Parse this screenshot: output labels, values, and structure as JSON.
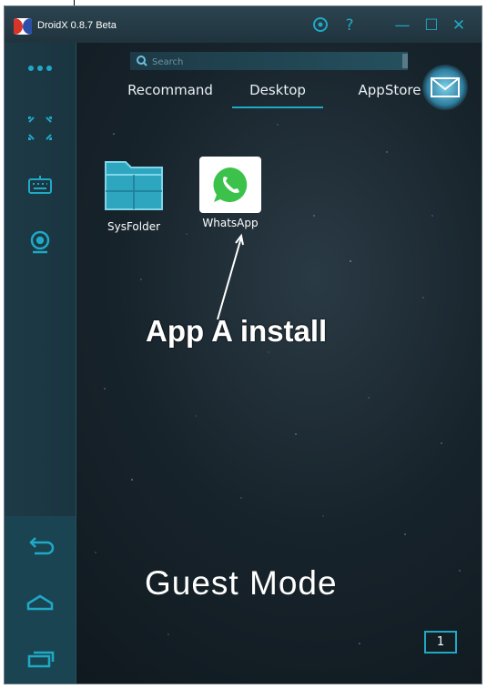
{
  "window": {
    "title": "DroidX 0.8.7 Beta",
    "accent_color": "#1fa9c6",
    "titlebar_icons": [
      "settings-icon",
      "help-icon",
      "minimize-icon",
      "maximize-icon",
      "close-icon"
    ],
    "help_glyph": "?",
    "minimize_glyph": "—",
    "maximize_glyph": "☐",
    "close_glyph": "✕"
  },
  "sidebar": {
    "top_icons": [
      "more-dots-icon",
      "fullscreen-icon",
      "keyboard-icon",
      "camera-icon"
    ],
    "bottom_icons": [
      "back-icon",
      "home-icon",
      "recent-apps-icon"
    ]
  },
  "search": {
    "placeholder": "Search"
  },
  "tabs": [
    {
      "label": "Recommand",
      "active": false
    },
    {
      "label": "Desktop",
      "active": true
    },
    {
      "label": "AppStore",
      "active": false
    }
  ],
  "mail_icon": "mail-icon",
  "desktop_apps": [
    {
      "label": "SysFolder",
      "icon": "folder-icon"
    },
    {
      "label": "WhatsApp",
      "icon": "whatsapp-icon"
    }
  ],
  "annotation": {
    "text": "App A install"
  },
  "mode_label": "Guest Mode",
  "page_indicator": "1"
}
